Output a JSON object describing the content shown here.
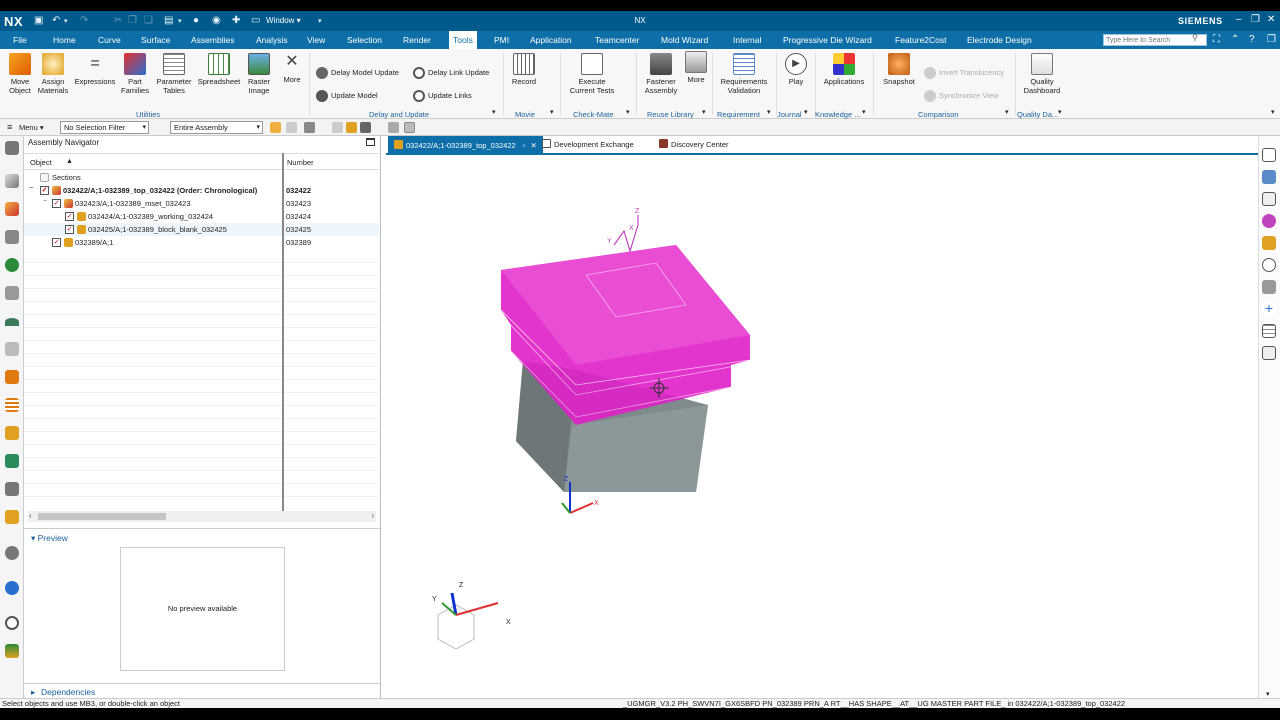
{
  "titlebar": {
    "logo": "NX",
    "window_menu": "Window ▾",
    "app_title": "NX",
    "brand": "SIEMENS"
  },
  "menubar": {
    "items": [
      "File",
      "Home",
      "Curve",
      "Surface",
      "Assemblies",
      "Analysis",
      "View",
      "Selection",
      "Render",
      "Tools",
      "PMI",
      "Application",
      "Teamcenter",
      "Mold Wizard",
      "Internal",
      "Progressive Die Wizard",
      "Feature2Cost",
      "Electrode Design"
    ],
    "active": "Tools",
    "search_placeholder": "Type Here to Search"
  },
  "ribbon": {
    "utilities": {
      "move_object": "Move\nObject",
      "assign_materials": "Assign\nMaterials",
      "expressions": "Expressions",
      "part_families": "Part\nFamilies",
      "parameter_tables": "Parameter\nTables",
      "spreadsheet": "Spreadsheet",
      "raster_image": "Raster\nImage",
      "more": "More",
      "label": "Utilities"
    },
    "delay": {
      "delay_model_update": "Delay Model Update",
      "update_model": "Update Model",
      "delay_link_update": "Delay Link Update",
      "update_links": "Update Links",
      "label": "Delay and Update"
    },
    "movie": {
      "record": "Record",
      "label": "Movie"
    },
    "checkmate": {
      "execute": "Execute\nCurrent Tests",
      "label": "Check-Mate"
    },
    "reuse": {
      "fastener": "Fastener\nAssembly",
      "more": "More",
      "label": "Reuse Library"
    },
    "requirement": {
      "validation": "Requirements\nValidation",
      "label": "Requirement"
    },
    "journal": {
      "play": "Play",
      "label": "Journal"
    },
    "knowledge": {
      "applications": "Applications",
      "label": "Knowledge ..."
    },
    "comparison": {
      "snapshot": "Snapshot",
      "invert": "Invert Translucency",
      "sync": "Synchronize View",
      "label": "Comparison"
    },
    "quality": {
      "dashboard": "Quality\nDashboard",
      "label": "Quality Da..."
    }
  },
  "seltoolbar": {
    "menu": "Menu ▾",
    "filter": "No Selection Filter",
    "scope": "Entire Assembly"
  },
  "navigator": {
    "title": "Assembly Navigator",
    "col_object": "Object",
    "col_number": "Number",
    "rows": [
      {
        "label": "Sections",
        "number": ""
      },
      {
        "label": "032422/A;1-032389_top_032422 (Order: Chronological)",
        "number": "032422"
      },
      {
        "label": "032423/A;1-032389_mset_032423",
        "number": "032423"
      },
      {
        "label": "032424/A;1-032389_working_032424",
        "number": "032424"
      },
      {
        "label": "032425/A;1-032389_block_blank_032425",
        "number": "032425"
      },
      {
        "label": "032389/A;1",
        "number": "032389"
      }
    ],
    "preview_title": "Preview",
    "preview_text": "No preview available",
    "dependencies": "Dependencies"
  },
  "graphics": {
    "tabs": [
      "032422/A;1-032389_top_032422",
      "Development Exchange",
      "Discovery Center"
    ],
    "triad": {
      "x": "X",
      "y": "Y",
      "z": "Z"
    }
  },
  "status": {
    "left": "Select objects and use MB3, or double-click an object",
    "right": "_UGMGR_V3.2 PH_SWVN7I_GX6SBFD PN_032389 PRN_A RT__HAS SHAPE__AT__UG MASTER PART FILE_  in 032422/A;1-032389_top_032422"
  },
  "colors": {
    "title_bar": "#005a8c",
    "menu_bar": "#0d6ea8",
    "magenta_body": "#e020c8",
    "gray_block": "#7f8a8c"
  }
}
